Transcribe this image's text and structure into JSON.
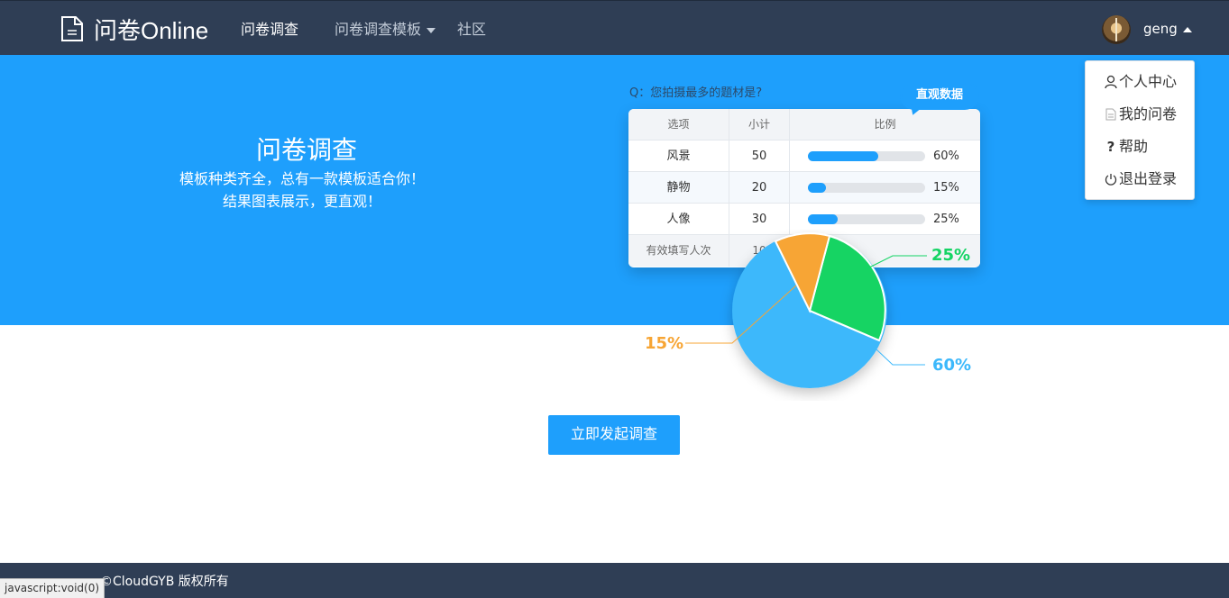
{
  "brand": {
    "name": "问卷Online",
    "icon": "document-icon"
  },
  "nav": {
    "items": [
      {
        "label": "问卷调查",
        "active": true
      },
      {
        "label": "问卷调查模板",
        "has_caret": true
      },
      {
        "label": "社区"
      }
    ]
  },
  "user": {
    "name": "geng",
    "menu": [
      {
        "icon": "user-icon",
        "label": "个人中心"
      },
      {
        "icon": "file-icon",
        "label": "我的问卷"
      },
      {
        "icon": "question-icon",
        "label": "帮助"
      },
      {
        "icon": "power-icon",
        "label": "退出登录"
      }
    ]
  },
  "hero": {
    "title": "问卷调查",
    "subtitle_1": "模板种类齐全，总有一款模板适合你！",
    "subtitle_2": "结果图表展示，更直观！",
    "question": "Q：您拍摄最多的题材是?",
    "bubble": "直观数据",
    "table": {
      "headers": [
        "选项",
        "小计",
        "比例"
      ],
      "rows": [
        {
          "option": "风景",
          "count": "50",
          "ratio": 0.6,
          "ratio_label": "60%"
        },
        {
          "option": "静物",
          "count": "20",
          "ratio": 0.15,
          "ratio_label": "15%"
        },
        {
          "option": "人像",
          "count": "30",
          "ratio": 0.25,
          "ratio_label": "25%"
        }
      ],
      "footer_label": "有效填写人次",
      "footer_value": "10"
    },
    "pie_labels": [
      {
        "label": "25%",
        "color": "#14d464"
      },
      {
        "label": "15%",
        "color": "#f7a534"
      },
      {
        "label": "60%",
        "color": "#3cb8fb"
      }
    ]
  },
  "cta": {
    "label": "立即发起调查"
  },
  "footer": {
    "copyright": "©CloudGYB 版权所有"
  },
  "status_bar": "javascript:void(0)",
  "colors": {
    "nav": "#2f3e55",
    "primary": "#1e9ffc"
  }
}
